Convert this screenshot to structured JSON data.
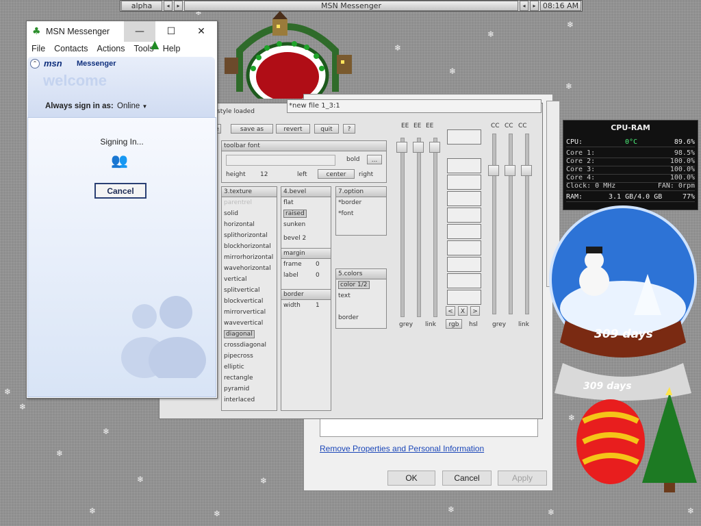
{
  "toolbar": {
    "workspace": "alpha",
    "window_title": "MSN Messenger",
    "clock": "08:16 AM"
  },
  "msn": {
    "title": "MSN Messenger",
    "menu": [
      "File",
      "Contacts",
      "Actions",
      "Tools",
      "Help"
    ],
    "logo_msn": "msn",
    "logo_messenger": "Messenger",
    "welcome": "welcome",
    "sign_in_label": "Always sign in as:",
    "status": "Online",
    "signing_in": "Signing In...",
    "cancel": "Cancel"
  },
  "editor": {
    "status": "style loaded",
    "tab_title": "*new file 1_3:1",
    "buttons": [
      "save as",
      "revert",
      "quit",
      "?"
    ],
    "toolbar_font": "toolbar font",
    "bold": "bold",
    "ellipsis": "...",
    "height_label": "height",
    "height_value": "12",
    "align_left": "left",
    "align_center": "center",
    "align_right": "right",
    "texture": {
      "header": "3.texture",
      "items": [
        "parentrel",
        "solid",
        "horizontal",
        "splithorizontal",
        "blockhorizontal",
        "mirrorhorizontal",
        "wavehorizontal",
        "vertical",
        "splitvertical",
        "blockvertical",
        "mirrorvertical",
        "wavevertical",
        "diagonal",
        "crossdiagonal",
        "pipecross",
        "elliptic",
        "rectangle",
        "pyramid",
        "interlaced"
      ],
      "selected": "diagonal"
    },
    "bevel": {
      "header": "4.bevel",
      "items": [
        "flat",
        "raised",
        "sunken",
        "bevel 2"
      ],
      "selected": "raised"
    },
    "margin": {
      "header": "margin",
      "frame_label": "frame",
      "frame_value": "0",
      "label_label": "label",
      "label_value": "0"
    },
    "border": {
      "header": "border",
      "width_label": "width",
      "width_value": "1"
    },
    "option": {
      "header": "7.option",
      "items": [
        "*border",
        "*font"
      ]
    },
    "colors": {
      "header": "5.colors",
      "items": [
        "color 1/2",
        "text",
        "border"
      ]
    },
    "slider_labels_left": [
      "EE",
      "EE",
      "EE"
    ],
    "slider_labels_right": [
      "CC",
      "CC",
      "CC"
    ],
    "bottom_labels": [
      "grey",
      "link",
      "rgb",
      "hsl",
      "grey",
      "link"
    ],
    "nav": [
      "<",
      "X",
      ">"
    ]
  },
  "props": {
    "link": "Remove Properties and Personal Information",
    "ok": "OK",
    "cancel": "Cancel",
    "apply": "Apply"
  },
  "cpu": {
    "title": "CPU-RAM",
    "cpu_label": "CPU:",
    "temp": "0°C",
    "cpu_value": "89.6%",
    "cores": [
      {
        "label": "Core 1:",
        "value": "98.5%"
      },
      {
        "label": "Core 2:",
        "value": "100.0%"
      },
      {
        "label": "Core 3:",
        "value": "100.0%"
      },
      {
        "label": "Core 4:",
        "value": "100.0%"
      }
    ],
    "clock": "Clock: 0 MHz",
    "fan": "FAN: 0rpm",
    "ram_label": "RAM:",
    "ram_value": "3.1 GB/4.0 GB",
    "ram_percent": "77%"
  },
  "globe": {
    "days_text": "309 days",
    "days_text2": "309 days"
  }
}
